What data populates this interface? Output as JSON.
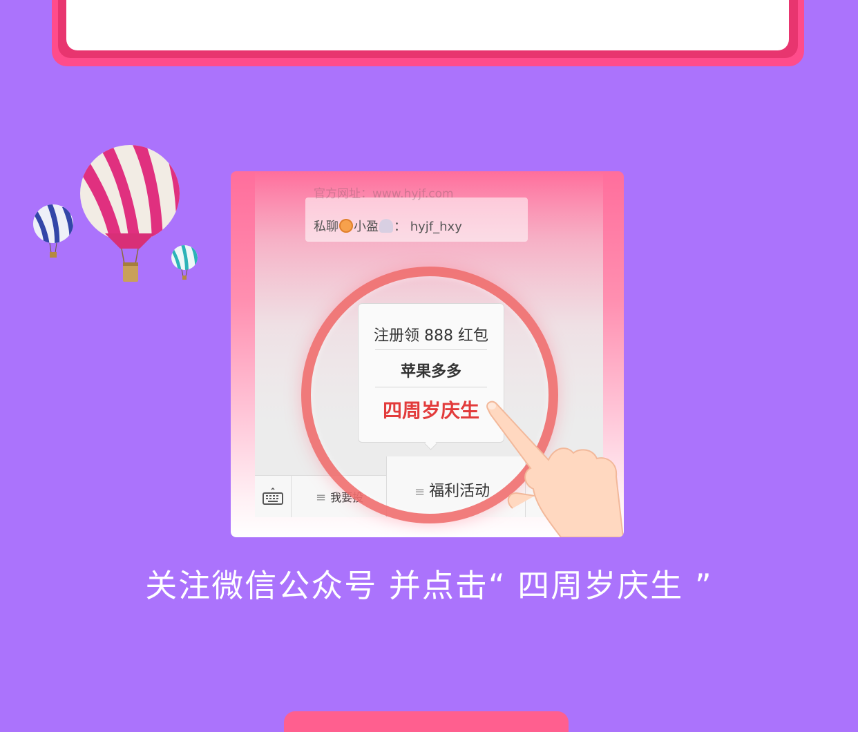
{
  "colors": {
    "background": "#ab73fc",
    "card_pink": "#ff4c8b",
    "highlight_red": "#e23b3b",
    "text_white": "#ffffff"
  },
  "screenshot": {
    "faded_line": "官方网址：www.hyjf.com",
    "private_chat": {
      "prefix": "私聊",
      "name": "小盈",
      "separator": "：",
      "account": "hyjf_hxy"
    },
    "popup_menu": {
      "items": [
        "注册领 888 红包",
        "苹果多多",
        "四周岁庆生"
      ]
    },
    "bottom_menu": {
      "left_label": "我要投",
      "middle_label": "福利活动"
    },
    "icons": [
      "keyboard-icon",
      "menu-lines-icon",
      "pointing-hand-icon",
      "hot-air-balloon-icon"
    ]
  },
  "caption": "关注微信公众号  并点击“ 四周岁庆生 ”"
}
